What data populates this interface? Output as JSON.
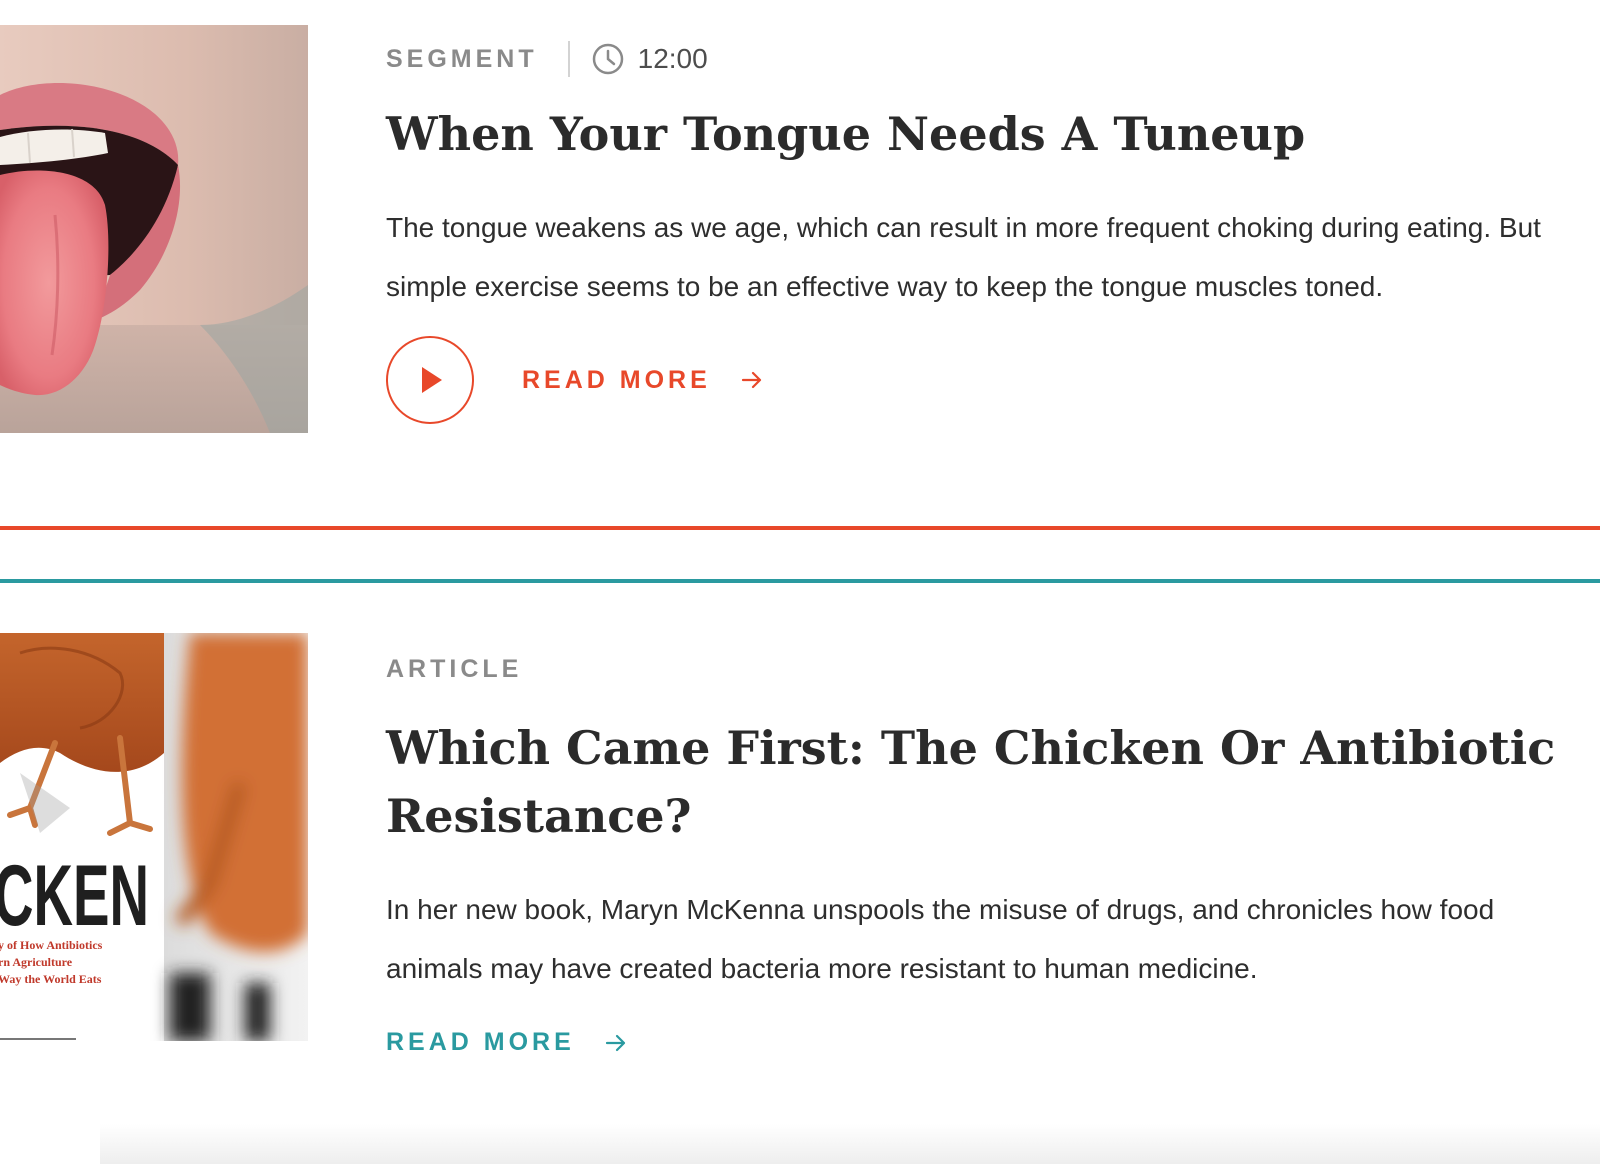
{
  "entries": [
    {
      "type": "SEGMENT",
      "duration": "12:00",
      "title": "When Your Tongue Needs A Tuneup",
      "description": "The tongue weakens as we age, which can result in more frequent choking during eating. But simple exercise seems to be an effective way to keep the tongue muscles toned.",
      "read_more": "READ MORE",
      "accent": "#e8482a",
      "icons": [
        "clock-icon",
        "play-icon",
        "arrow-right-icon"
      ]
    },
    {
      "type": "ARTICLE",
      "title": "Which Came First: The Chicken Or Antibiotic Resistance?",
      "description": "In her new book, Maryn McKenna unspools the misuse of drugs, and chronicles how food animals may have created bacteria more resistant to human medicine.",
      "read_more": "READ MORE",
      "accent": "#2a9aa0",
      "book_cover": {
        "title_fragment": "CKEN",
        "subtitle_lines": [
          "y of How Antibiotics",
          "rn Agriculture",
          "Way the World Eats"
        ]
      },
      "icons": [
        "arrow-right-icon"
      ]
    }
  ],
  "colors": {
    "orange": "#e8482a",
    "teal": "#2a9aa0",
    "meta_gray": "#8a8a8a",
    "text": "#2b2b2b"
  }
}
